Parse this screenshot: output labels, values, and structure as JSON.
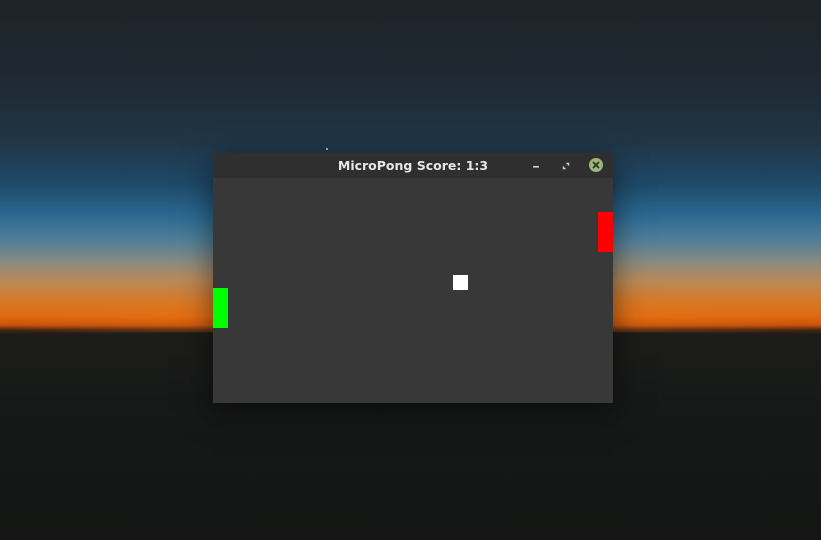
{
  "window": {
    "title": "MicroPong Score: 1:3",
    "buttons": {
      "minimize": "minimize-icon",
      "maximize": "restore-icon",
      "close": "close-icon"
    }
  },
  "game": {
    "left_paddle_color": "#00ff00",
    "right_paddle_color": "#ff0000",
    "ball_color": "#ffffff",
    "court_color": "#383838"
  }
}
